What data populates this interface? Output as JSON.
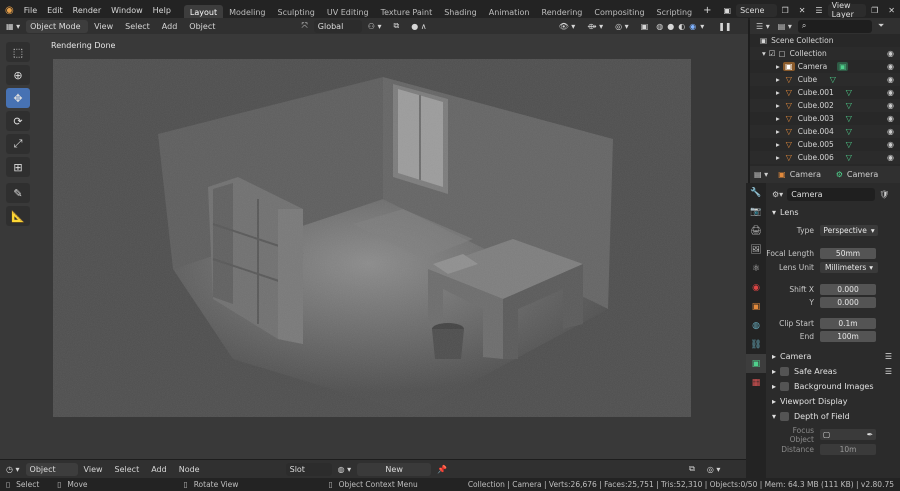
{
  "topbar": {
    "menus": [
      "File",
      "Edit",
      "Render",
      "Window",
      "Help"
    ],
    "tabs": [
      "Layout",
      "Modeling",
      "Sculpting",
      "UV Editing",
      "Texture Paint",
      "Shading",
      "Animation",
      "Rendering",
      "Compositing",
      "Scripting"
    ],
    "active_tab": "Layout",
    "add_tab": "+",
    "scene": "Scene",
    "view_layer": "View Layer"
  },
  "viewport_header": {
    "mode": "Object Mode",
    "menus": [
      "View",
      "Select",
      "Add",
      "Object"
    ],
    "orientation": "Global"
  },
  "viewport": {
    "status": "Rendering Done"
  },
  "outliner": {
    "search_placeholder": "",
    "items": [
      {
        "name": "Scene Collection"
      },
      {
        "name": "Collection"
      },
      {
        "name": "Camera"
      },
      {
        "name": "Cube"
      },
      {
        "name": "Cube.001"
      },
      {
        "name": "Cube.002"
      },
      {
        "name": "Cube.003"
      },
      {
        "name": "Cube.004"
      },
      {
        "name": "Cube.005"
      },
      {
        "name": "Cube.006"
      }
    ]
  },
  "properties": {
    "header_object": "Camera",
    "header_data": "Camera",
    "data_name": "Camera",
    "lens_section": "Lens",
    "type_label": "Type",
    "type_value": "Perspective",
    "focal_label": "Focal Length",
    "focal_value": "50mm",
    "lens_unit_label": "Lens Unit",
    "lens_unit_value": "Millimeters",
    "shift_x_label": "Shift X",
    "shift_x_value": "0.000",
    "shift_y_label": "Y",
    "shift_y_value": "0.000",
    "clip_start_label": "Clip Start",
    "clip_start_value": "0.1m",
    "clip_end_label": "End",
    "clip_end_value": "100m",
    "camera_section": "Camera",
    "safe_areas": "Safe Areas",
    "background_images": "Background Images",
    "viewport_display": "Viewport Display",
    "depth_of_field": "Depth of Field",
    "focus_object_label": "Focus Object",
    "distance_label": "Distance",
    "distance_value": "10m"
  },
  "node_header": {
    "mode": "Object",
    "menus": [
      "View",
      "Select",
      "Add",
      "Node"
    ],
    "slot": "Slot",
    "new_button": "New"
  },
  "statusbar": {
    "select": "Select",
    "move": "Move",
    "rotate_view": "Rotate View",
    "context_menu": "Object Context Menu",
    "stats": "Collection | Camera | Verts:26,676 | Faces:25,751 | Tris:52,310 | Objects:0/50 | Mem: 64.3 MB (111 KB) | v2.80.75"
  }
}
